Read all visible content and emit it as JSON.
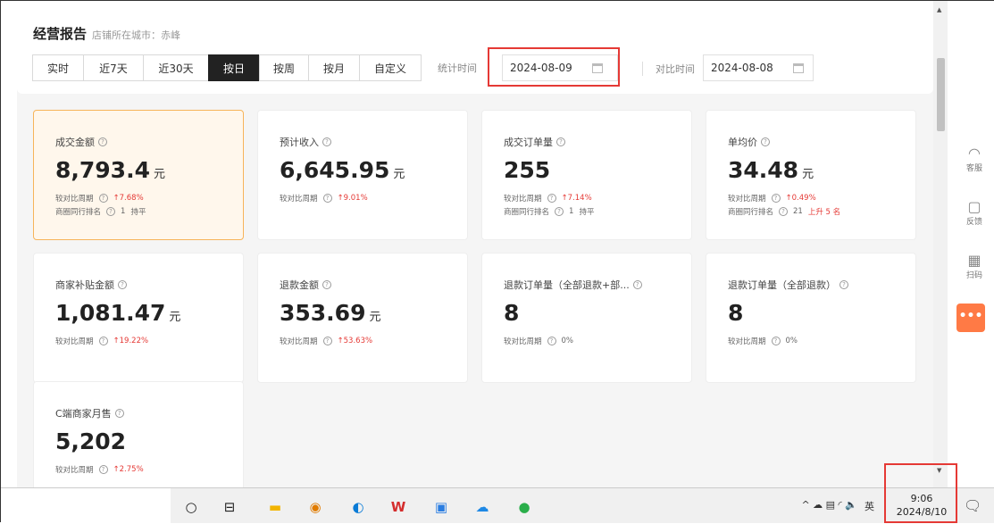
{
  "header": {
    "title": "经营报告",
    "city_label": "店铺所在城市：赤峰"
  },
  "range_tabs": [
    {
      "label": "实时",
      "active": false
    },
    {
      "label": "近7天",
      "active": false
    },
    {
      "label": "近30天",
      "active": false
    },
    {
      "label": "按日",
      "active": true
    },
    {
      "label": "按周",
      "active": false
    },
    {
      "label": "按月",
      "active": false
    },
    {
      "label": "自定义",
      "active": false
    }
  ],
  "stat_time": {
    "label": "统计时间",
    "value": "2024-08-09"
  },
  "compare_time": {
    "label": "对比时间",
    "value": "2024-08-08"
  },
  "cards": [
    {
      "label": "成交金额",
      "value": "8,793.4",
      "unit": "元",
      "cmp_label": "较对比周期",
      "cmp_value": "7.68%",
      "rank_label": "商圈同行排名",
      "rank_value": "1",
      "rank_change": "持平",
      "selected": true
    },
    {
      "label": "预计收入",
      "value": "6,645.95",
      "unit": "元",
      "cmp_label": "较对比周期",
      "cmp_value": "9.01%",
      "selected": false
    },
    {
      "label": "成交订单量",
      "value": "255",
      "unit": "",
      "cmp_label": "较对比周期",
      "cmp_value": "7.14%",
      "rank_label": "商圈同行排名",
      "rank_value": "1",
      "rank_change": "持平",
      "selected": false
    },
    {
      "label": "单均价",
      "value": "34.48",
      "unit": "元",
      "cmp_label": "较对比周期",
      "cmp_value": "0.49%",
      "rank_label": "商圈同行排名",
      "rank_value": "21",
      "rank_change": "上升 5 名",
      "selected": false
    },
    {
      "label": "商家补贴金额",
      "value": "1,081.47",
      "unit": "元",
      "cmp_label": "较对比周期",
      "cmp_value": "19.22%",
      "selected": false
    },
    {
      "label": "退款金额",
      "value": "353.69",
      "unit": "元",
      "cmp_label": "较对比周期",
      "cmp_value": "53.63%",
      "selected": false
    },
    {
      "label": "退款订单量（全部退款+部...",
      "value": "8",
      "unit": "",
      "cmp_label": "较对比周期",
      "cmp_value": "0%",
      "selected": false
    },
    {
      "label": "退款订单量（全部退款）",
      "value": "8",
      "unit": "",
      "cmp_label": "较对比周期",
      "cmp_value": "0%",
      "selected": false
    },
    {
      "label": "C端商家月售",
      "value": "5,202",
      "unit": "",
      "cmp_label": "较对比周期",
      "cmp_value": "2.75%",
      "selected": false
    }
  ],
  "side_panel": [
    {
      "label": "客服",
      "icon": "headset-icon"
    },
    {
      "label": "反馈",
      "icon": "feedback-icon"
    },
    {
      "label": "扫码",
      "icon": "qr-code-icon"
    }
  ],
  "chat_button": {
    "icon": "chat-icon",
    "glyph": "•••",
    "color": "#ff7a45"
  },
  "taskbar": {
    "time": "9:06",
    "date": "2024/8/10",
    "ime": "英",
    "tray_glyphs": "^ ☁ ▤ ◜ 🔈"
  },
  "colors": {
    "accent": "#222222",
    "up": "#e53935",
    "selected_bg": "#fff7ec",
    "selected_border": "#f7b45a",
    "highlight": "#e53935"
  }
}
